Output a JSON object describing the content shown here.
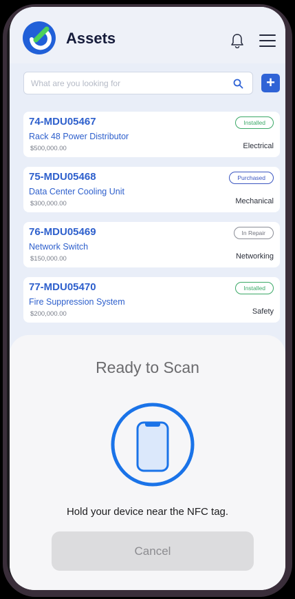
{
  "header": {
    "title": "Assets",
    "logo_icon": "app-logo-icon",
    "bell_icon": "bell-icon",
    "menu_icon": "hamburger-menu-icon"
  },
  "search": {
    "placeholder": "What are you looking for",
    "icon": "search-icon",
    "add_label": "+"
  },
  "assets": [
    {
      "id": "74-MDU05467",
      "name": "Rack 48 Power Distributor",
      "price": "$500,000.00",
      "category": "Electrical",
      "status": "Installed"
    },
    {
      "id": "75-MDU05468",
      "name": "Data Center Cooling Unit",
      "price": "$300,000.00",
      "category": "Mechanical",
      "status": "Purchased"
    },
    {
      "id": "76-MDU05469",
      "name": "Network Switch",
      "price": "$150,000.00",
      "category": "Networking",
      "status": "In Repair"
    },
    {
      "id": "77-MDU05470",
      "name": "Fire Suppression System",
      "price": "$200,000.00",
      "category": "Safety",
      "status": "Installed"
    }
  ],
  "nfc_sheet": {
    "title": "Ready to Scan",
    "message": "Hold your device near the NFC tag.",
    "cancel_label": "Cancel",
    "icon": "phone-scan-icon"
  },
  "colors": {
    "accent": "#2f63d6",
    "installed": "#3aa866",
    "purchased": "#3a55c0",
    "in_repair": "#8a8d96",
    "nfc_ring": "#1a73e8"
  }
}
